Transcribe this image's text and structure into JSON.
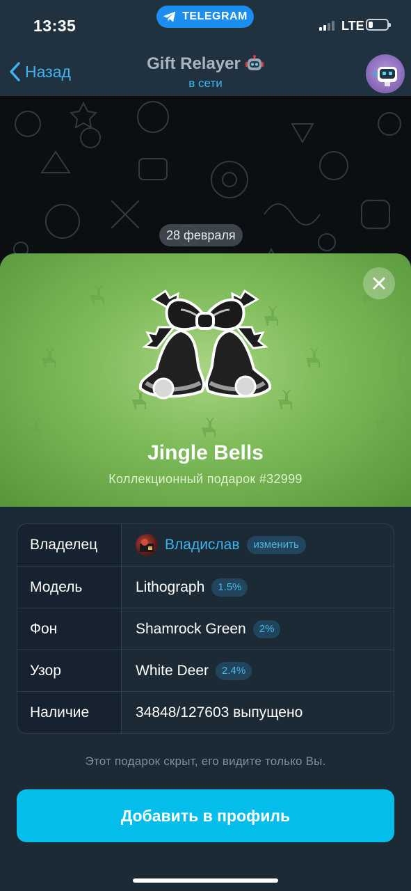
{
  "status_bar": {
    "time": "13:35",
    "app_pill": "TELEGRAM",
    "network": "LTE",
    "battery_level": 0.2
  },
  "nav": {
    "back_label": "Назад",
    "chat_name": "Gift Relayer",
    "chat_status": "в сети"
  },
  "chat": {
    "date": "28 февраля"
  },
  "gift": {
    "title": "Jingle Bells",
    "subtitle": "Коллекционный подарок #32999",
    "background_color": "#7fbc5a"
  },
  "info": {
    "owner": {
      "label": "Владелец",
      "name": "Владислав",
      "action": "изменить"
    },
    "model": {
      "label": "Модель",
      "value": "Lithograph",
      "rarity": "1.5%"
    },
    "backdrop": {
      "label": "Фон",
      "value": "Shamrock Green",
      "rarity": "2%"
    },
    "pattern": {
      "label": "Узор",
      "value": "White Deer",
      "rarity": "2.4%"
    },
    "availability": {
      "label": "Наличие",
      "value": "34848/127603 выпущено"
    }
  },
  "note": "Этот подарок скрыт, его видите только Вы.",
  "primary_button": "Добавить в профиль",
  "colors": {
    "accent": "#3fb4f0",
    "button": "#05bdeb",
    "sheet": "#1c2a36"
  }
}
